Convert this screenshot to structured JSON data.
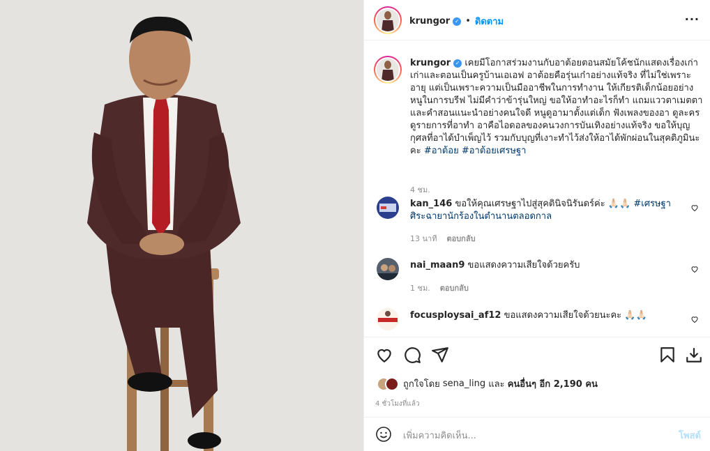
{
  "post": {
    "username": "krungor",
    "follow_label": "ติดตาม",
    "dot": "•",
    "more": "···"
  },
  "caption": {
    "username": "krungor",
    "text": "เคยมีโอกาสร่วมงานกับอาต้อยตอนสมัยโค้ชนักแสดงเรื่องเก่าเก่าและตอนเป็นครูบ้านเอเอฟ อาต้อยคือรุ่นเก๋าอย่างแท้จริง ที่ไม่ใช่เพราะอายุ แต่เป็นเพราะความเป็นมืออาชีพในการทำงาน ให้เกียรติเด็กน้อยอย่างหนูในการบรีฟ ไม่มีคำว่าข้ารุ่นใหญ่ ขอให้อาทำอะไรก็ทำ แถมแววตาเมตตาและคำสอนแนะนำอย่างคนใจดี หนูดูอามาตั้งแต่เด็ก ฟังเพลงของอา ดูละครดูรายการที่อาทำ อาคือไอดอลของคนวงการบันเทิงอย่างแท้จริง ขอให้บุญกุศลที่อาได้บำเพ็ญไว้ รวมกับบุญที่เงาะทำไว้ส่งให้อาได้พักผ่อนในสุคติภูมินะคะ",
    "hashtags": "#อาต้อย #อาต้อยเศรษฐา",
    "time": "4 ชม."
  },
  "comments": [
    {
      "username": "kan_146",
      "text": "ขอให้คุณเศรษฐาไปสู่สุคตินิจนิรันดร์ค่ะ 🙏🏻🙏🏻",
      "hashtag": "#เศรษฐาศิระฉายานักร้องในตำนานตลอดกาล",
      "time": "13 นาที",
      "reply": "ตอบกลับ"
    },
    {
      "username": "nai_maan9",
      "text": "ขอแสดงความเสียใจด้วยครับ",
      "time": "1 ชม.",
      "reply": "ตอบกลับ"
    },
    {
      "username": "focusploysai_af12",
      "text": "ขอแสดงความเสียใจด้วยนะคะ 🙏🏻🙏🏻"
    }
  ],
  "likes": {
    "prefix": "ถูกใจโดย",
    "user": "sena_ling",
    "and": "และ",
    "others": "คนอื่นๆ อีก 2,190 คน"
  },
  "post_time": "4 ชั่วโมงที่แล้ว",
  "add_comment": {
    "placeholder": "เพิ่มความคิดเห็น...",
    "post_label": "โพสต์"
  },
  "icons": [
    "heart-icon",
    "comment-icon",
    "share-icon",
    "bookmark-icon",
    "download-icon",
    "emoji-icon",
    "verified-icon",
    "more-icon"
  ]
}
